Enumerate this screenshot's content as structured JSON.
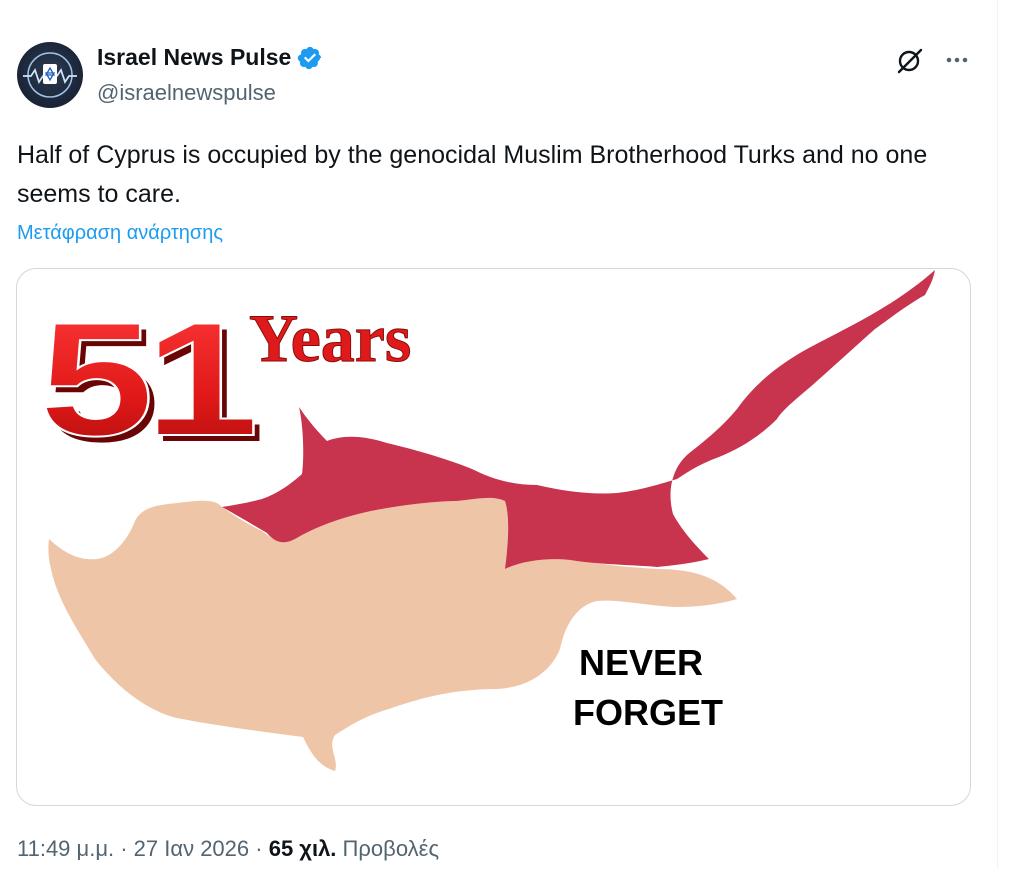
{
  "author": {
    "display_name": "Israel News Pulse",
    "handle": "@israelnewspulse",
    "verified": true,
    "verified_color": "#1d9bf0"
  },
  "tweet": {
    "text": "Half of Cyprus is occupied by the genocidal Muslim Brotherhood Turks and no one seems to care.",
    "translate_label": "Μετάφραση ανάρτησης"
  },
  "media": {
    "number": "51",
    "years": "Years",
    "never": "NEVER",
    "forget": "FORGET",
    "occupied_color": "#c8334d",
    "free_color": "#efc5a8"
  },
  "meta": {
    "time": "11:49 μ.μ.",
    "sep1": " · ",
    "date": "27 Ιαν 2026",
    "sep2": " · ",
    "views_count": "65 χιλ.",
    "views_label": " Προβολές"
  },
  "icons": {
    "grok": "grok-icon",
    "more": "more-icon",
    "verified": "verified-badge-icon"
  }
}
